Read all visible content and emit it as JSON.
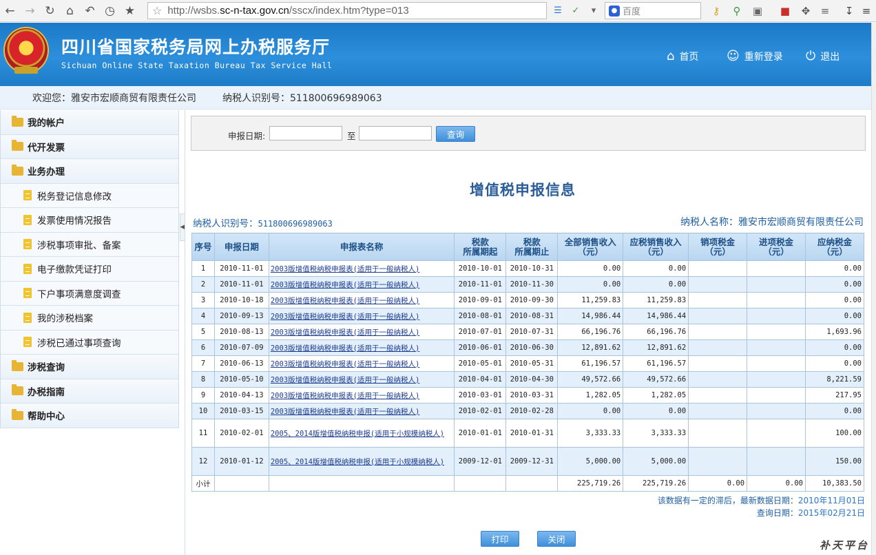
{
  "browser": {
    "url_host": "http://wsbs.",
    "url_domain": "sc-n-tax.gov.cn",
    "url_path": "/sscx/index.htm?type=013",
    "search_placeholder": "百度"
  },
  "header": {
    "title": "四川省国家税务局网上办税服务厅",
    "subtitle": "Sichuan Online State Taxation Bureau Tax Service Hall",
    "nav": [
      {
        "label": "首页",
        "icon": "home-icon"
      },
      {
        "label": "重新登录",
        "icon": "users-icon"
      },
      {
        "label": "退出",
        "icon": "power-icon"
      }
    ]
  },
  "welcome": {
    "greeting": "欢迎您：雅安市宏顺商贸有限责任公司",
    "taxpayer_id": "纳税人识别号：511800696989063"
  },
  "sidebar": {
    "items": [
      {
        "label": "我的帐户",
        "level": "top"
      },
      {
        "label": "代开发票",
        "level": "top"
      },
      {
        "label": "业务办理",
        "level": "top"
      },
      {
        "label": "税务登记信息修改",
        "level": "sub"
      },
      {
        "label": "发票使用情况报告",
        "level": "sub"
      },
      {
        "label": "涉税事项审批、备案",
        "level": "sub"
      },
      {
        "label": "电子缴款凭证打印",
        "level": "sub"
      },
      {
        "label": "下户事项满意度调查",
        "level": "sub"
      },
      {
        "label": "我的涉税档案",
        "level": "sub"
      },
      {
        "label": "涉税已通过事项查询",
        "level": "sub"
      },
      {
        "label": "涉税查询",
        "level": "top"
      },
      {
        "label": "办税指南",
        "level": "top"
      },
      {
        "label": "帮助中心",
        "level": "top"
      }
    ]
  },
  "search": {
    "date_label": "申报日期:",
    "to_label": "至",
    "from_value": "",
    "to_value": "",
    "query_button": "查询"
  },
  "page": {
    "title": "增值税申报信息",
    "taxpayer_id_label": "纳税人识别号：",
    "taxpayer_id_value": "511800696989063",
    "taxpayer_name": "纳税人名称：雅安市宏顺商贸有限责任公司"
  },
  "table": {
    "headers": [
      "序号",
      "申报日期",
      "申报表名称",
      "税款\n所属期起",
      "税款\n所属期止",
      "全部销售收入\n（元）",
      "应税销售收入\n（元）",
      "销项税金\n（元）",
      "进项税金\n（元）",
      "应纳税金\n（元）"
    ],
    "rows": [
      [
        "1",
        "2010-11-01",
        "2003版增值税纳税申报表(适用于一般纳税人)",
        "2010-10-01",
        "2010-10-31",
        "0.00",
        "0.00",
        "",
        "",
        "0.00"
      ],
      [
        "2",
        "2010-11-01",
        "2003版增值税纳税申报表(适用于一般纳税人)",
        "2010-11-01",
        "2010-11-30",
        "0.00",
        "0.00",
        "",
        "",
        "0.00"
      ],
      [
        "3",
        "2010-10-18",
        "2003版增值税纳税申报表(适用于一般纳税人)",
        "2010-09-01",
        "2010-09-30",
        "11,259.83",
        "11,259.83",
        "",
        "",
        "0.00"
      ],
      [
        "4",
        "2010-09-13",
        "2003版增值税纳税申报表(适用于一般纳税人)",
        "2010-08-01",
        "2010-08-31",
        "14,986.44",
        "14,986.44",
        "",
        "",
        "0.00"
      ],
      [
        "5",
        "2010-08-13",
        "2003版增值税纳税申报表(适用于一般纳税人)",
        "2010-07-01",
        "2010-07-31",
        "66,196.76",
        "66,196.76",
        "",
        "",
        "1,693.96"
      ],
      [
        "6",
        "2010-07-09",
        "2003版增值税纳税申报表(适用于一般纳税人)",
        "2010-06-01",
        "2010-06-30",
        "12,891.62",
        "12,891.62",
        "",
        "",
        "0.00"
      ],
      [
        "7",
        "2010-06-13",
        "2003版增值税纳税申报表(适用于一般纳税人)",
        "2010-05-01",
        "2010-05-31",
        "61,196.57",
        "61,196.57",
        "",
        "",
        "0.00"
      ],
      [
        "8",
        "2010-05-10",
        "2003版增值税纳税申报表(适用于一般纳税人)",
        "2010-04-01",
        "2010-04-30",
        "49,572.66",
        "49,572.66",
        "",
        "",
        "8,221.59"
      ],
      [
        "9",
        "2010-04-13",
        "2003版增值税纳税申报表(适用于一般纳税人)",
        "2010-03-01",
        "2010-03-31",
        "1,282.05",
        "1,282.05",
        "",
        "",
        "217.95"
      ],
      [
        "10",
        "2010-03-15",
        "2003版增值税纳税申报表(适用于一般纳税人)",
        "2010-02-01",
        "2010-02-28",
        "0.00",
        "0.00",
        "",
        "",
        "0.00"
      ],
      [
        "11",
        "2010-02-01",
        "2005、2014版增值税纳税申报(适用于小规模纳税人)",
        "2010-01-01",
        "2010-01-31",
        "3,333.33",
        "3,333.33",
        "",
        "",
        "100.00"
      ],
      [
        "12",
        "2010-01-12",
        "2005、2014版增值税纳税申报(适用于小规模纳税人)",
        "2009-12-01",
        "2009-12-31",
        "5,000.00",
        "5,000.00",
        "",
        "",
        "150.00"
      ]
    ],
    "subtotal": [
      "小计",
      "",
      "",
      "",
      "",
      "225,719.26",
      "225,719.26",
      "0.00",
      "0.00",
      "10,383.50"
    ]
  },
  "notes": {
    "line1_prefix": "该数据有一定的滞后，最新数据日期：",
    "line1_date": "2010年11月01日",
    "line2_prefix": "查询日期：",
    "line2_date": "2015年02月21日"
  },
  "actions": {
    "print": "打印",
    "close": "关闭"
  },
  "watermark": "补天平台"
}
